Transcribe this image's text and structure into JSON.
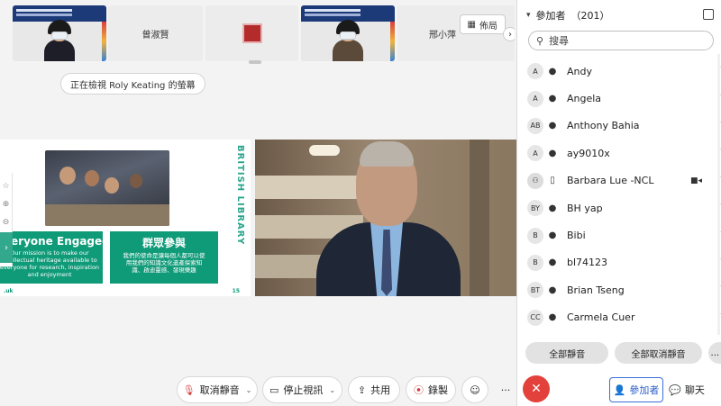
{
  "filmstrip": {
    "tiles": [
      {
        "type": "video",
        "name": ""
      },
      {
        "type": "name",
        "name": "曾淑賢"
      },
      {
        "type": "seal",
        "name": ""
      },
      {
        "type": "video",
        "name": ""
      },
      {
        "type": "name",
        "name": "邢小萍"
      }
    ],
    "layout_label": "佈局"
  },
  "viewing_banner": "正在檢視 Roly Keating 的螢幕",
  "slide": {
    "brand": "BRITISH LIBRARY",
    "card_en_title": "Everyone Engaged",
    "card_en_body": "Our mission is to make our intellectual heritage available to everyone for research, inspiration and enjoyment",
    "card_zh_title": "群眾參與",
    "card_zh_body": "我們的使命是讓每個人都可以使用我們的知識文化遺產探索知識、啟迪靈感、發現樂趣",
    "footer_left": ".uk",
    "page_number": "15"
  },
  "participants": {
    "title": "參加者",
    "count": "（201）",
    "search_placeholder": "搜尋",
    "list": [
      {
        "initials": "A",
        "name": "Andy",
        "camera": false
      },
      {
        "initials": "A",
        "name": "Angela",
        "camera": false
      },
      {
        "initials": "AB",
        "name": "Anthony Bahia",
        "camera": false
      },
      {
        "initials": "A",
        "name": "ay9010x",
        "camera": false
      },
      {
        "initials": "",
        "name": "Barbara Lue -NCL",
        "camera": true
      },
      {
        "initials": "BY",
        "name": "BH yap",
        "camera": false
      },
      {
        "initials": "B",
        "name": "Bibi",
        "camera": false
      },
      {
        "initials": "B",
        "name": "bl74123",
        "camera": false
      },
      {
        "initials": "BT",
        "name": "Brian Tseng",
        "camera": false
      },
      {
        "initials": "CC",
        "name": "Carmela Cuer",
        "camera": false
      }
    ],
    "mute_all": "全部靜音",
    "unmute_all": "全部取消靜音",
    "more": "..."
  },
  "toolbar": {
    "unmute": "取消靜音",
    "stop_video": "停止視訊",
    "share": "共用",
    "record": "錄製",
    "more": "···",
    "participants_tab": "參加者",
    "chat_tab": "聊天"
  }
}
